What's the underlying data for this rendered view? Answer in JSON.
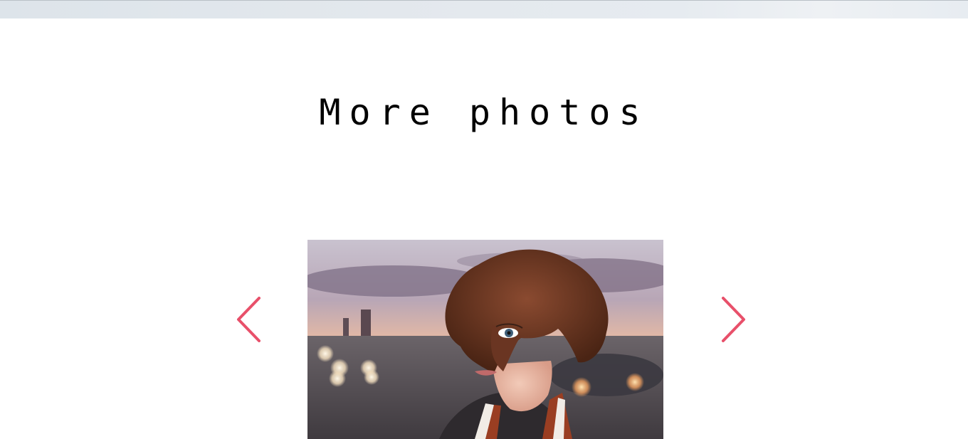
{
  "section": {
    "title": "More photos"
  },
  "carousel": {
    "prev_icon": "chevron-left-icon",
    "next_icon": "chevron-right-icon",
    "arrow_color": "#e8506a",
    "current_photo": "woman-portrait-photo"
  }
}
